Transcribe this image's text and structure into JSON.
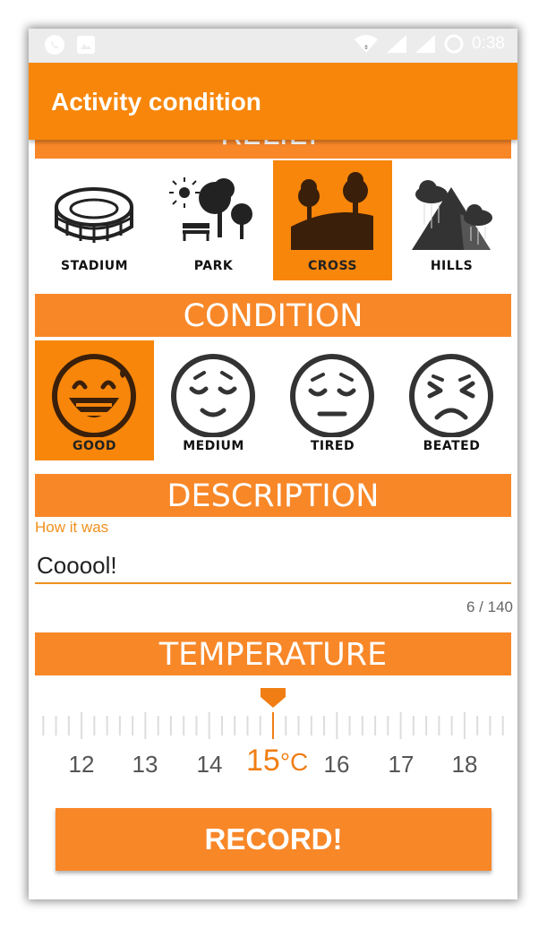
{
  "status_bar": {
    "time": "0:38",
    "icons": [
      "whatsapp-icon",
      "image-icon",
      "wifi-icon",
      "signal-icon",
      "signal-icon",
      "loading-icon"
    ]
  },
  "app_bar": {
    "title": "Activity condition"
  },
  "relief": {
    "header": "RELIEF",
    "items": [
      {
        "label": "STADIUM",
        "icon": "stadium-icon",
        "selected": false
      },
      {
        "label": "PARK",
        "icon": "park-icon",
        "selected": false
      },
      {
        "label": "CROSS",
        "icon": "cross-icon",
        "selected": true
      },
      {
        "label": "HILLS",
        "icon": "hills-icon",
        "selected": false
      }
    ]
  },
  "condition": {
    "header": "CONDITION",
    "items": [
      {
        "label": "GOOD",
        "icon": "good-face-icon",
        "selected": true
      },
      {
        "label": "MEDIUM",
        "icon": "medium-face-icon",
        "selected": false
      },
      {
        "label": "TIRED",
        "icon": "tired-face-icon",
        "selected": false
      },
      {
        "label": "BEATED",
        "icon": "beated-face-icon",
        "selected": false
      }
    ]
  },
  "description": {
    "header": "DESCRIPTION",
    "field_label": "How it was",
    "value": "Cooool!",
    "counter": "6 / 140"
  },
  "temperature": {
    "header": "TEMPERATURE",
    "ticks": [
      "12",
      "13",
      "14",
      "16",
      "17",
      "18"
    ],
    "current_value": "15",
    "unit": "°C"
  },
  "record_button": "RECORD!",
  "colors": {
    "accent": "#f7860a",
    "banner": "#f88728",
    "status_bar": "#ececec"
  }
}
